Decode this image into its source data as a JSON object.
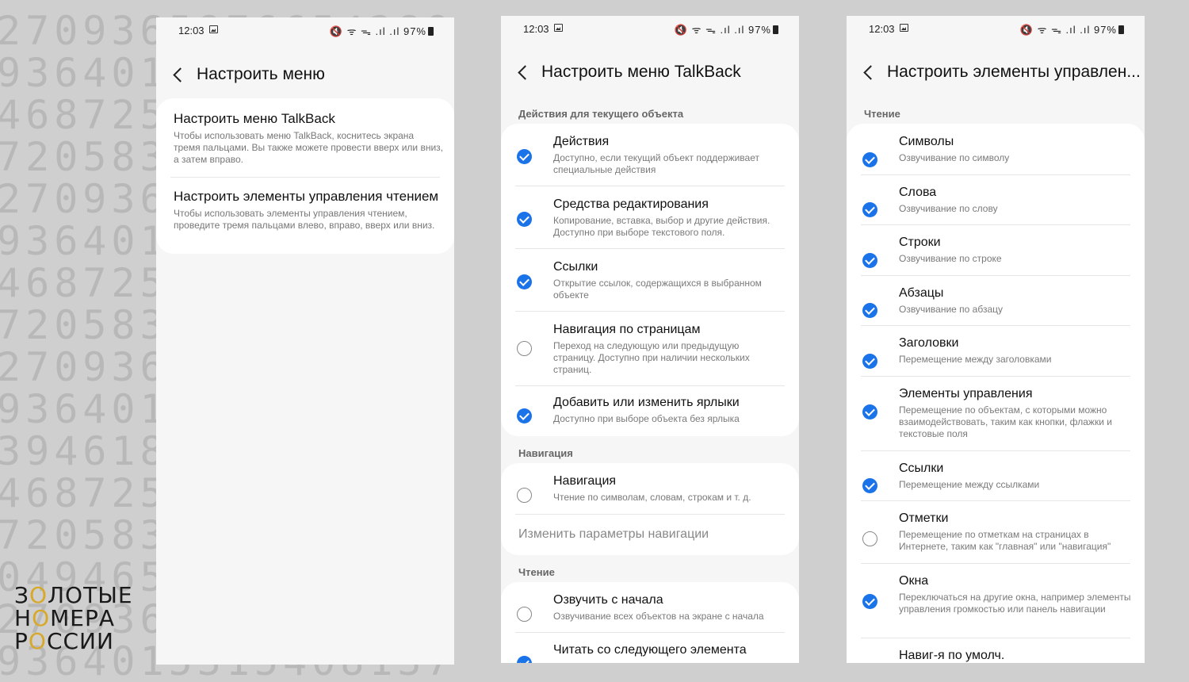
{
  "status_bar": {
    "time": "12:03",
    "indicators": "🔇 ᯤ ᯓ .ıl .ıl",
    "battery": "97%"
  },
  "background_digits": [
    "2709365876654289",
    "9364015315408137",
    "4687253628153621",
    "7205839136425939",
    "2709365876654289",
    "9364015315408137",
    "4687253628153621",
    "7205839136425939",
    "2709365876654289",
    "9364015315408137",
    "3946185381539467",
    "4687253628153621",
    "7205839136425939",
    "0494659874654289",
    "2709365876654289",
    "9364015315408137"
  ],
  "logo": {
    "line1": [
      "З",
      "О",
      "ЛОТЫЕ"
    ],
    "line2": [
      "Н",
      "О",
      "МЕРА"
    ],
    "line3": [
      "Р",
      "О",
      "ССИИ"
    ]
  },
  "screen1": {
    "title": "Настроить меню",
    "items": [
      {
        "title": "Настроить меню TalkBack",
        "desc": "Чтобы использовать меню TalkBack, коснитесь экрана тремя пальцами. Вы также можете провести вверх или вниз, а затем вправо."
      },
      {
        "title": "Настроить элементы управления чтением",
        "desc": "Чтобы использовать элементы управления чтением, проведите тремя пальцами влево, вправо, вверх или вниз."
      }
    ]
  },
  "screen2": {
    "title": "Настроить меню TalkBack",
    "section1": "Действия для текущего объекта",
    "section1_items": [
      {
        "title": "Действия",
        "desc": "Доступно, если текущий объект поддерживает специальные действия",
        "checked": true
      },
      {
        "title": "Средства редактирования",
        "desc": "Копирование, вставка, выбор и другие действия. Доступно при выборе текстового поля.",
        "checked": true
      },
      {
        "title": "Ссылки",
        "desc": "Открытие ссылок, содержащихся в выбранном объекте",
        "checked": true
      },
      {
        "title": "Навигация по страницам",
        "desc": "Переход на следующую или предыдущую страницу. Доступно при наличии нескольких страниц.",
        "checked": false
      },
      {
        "title": "Добавить или изменить ярлыки",
        "desc": "Доступно при выборе объекта без ярлыка",
        "checked": true
      }
    ],
    "section2": "Навигация",
    "nav_item": {
      "title": "Навигация",
      "desc": "Чтение по символам, словам, строкам и т. д.",
      "checked": false
    },
    "nav_link": "Изменить параметры навигации",
    "section3": "Чтение",
    "section3_items": [
      {
        "title": "Озвучить с начала",
        "desc": "Озвучивание всех объектов на экране с начала",
        "checked": false
      },
      {
        "title": "Читать со следующего элемента",
        "desc": "",
        "checked": true
      }
    ]
  },
  "screen3": {
    "title": "Настроить элементы управлен...",
    "section": "Чтение",
    "items": [
      {
        "title": "Символы",
        "desc": "Озвучивание по символу",
        "checked": true
      },
      {
        "title": "Слова",
        "desc": "Озвучивание по слову",
        "checked": true
      },
      {
        "title": "Строки",
        "desc": "Озвучивание по строке",
        "checked": true
      },
      {
        "title": "Абзацы",
        "desc": "Озвучивание по абзацу",
        "checked": true
      },
      {
        "title": "Заголовки",
        "desc": "Перемещение между заголовками",
        "checked": true
      },
      {
        "title": "Элементы управления",
        "desc": "Перемещение по объектам, с которыми можно взаимодействовать, таким как кнопки, флажки и текстовые поля",
        "checked": true
      },
      {
        "title": "Ссылки",
        "desc": "Перемещение между ссылками",
        "checked": true
      },
      {
        "title": "Отметки",
        "desc": "Перемещение по отметкам на страницах в Интернете, таким как \"главная\" или \"навигация\"",
        "checked": false
      },
      {
        "title": "Окна",
        "desc": "Переключаться на другие окна, например элементы управления громкостью или панель навигации",
        "checked": true
      },
      {
        "title": "Навиг-я по умолч.",
        "desc": "",
        "checked": false
      }
    ]
  }
}
